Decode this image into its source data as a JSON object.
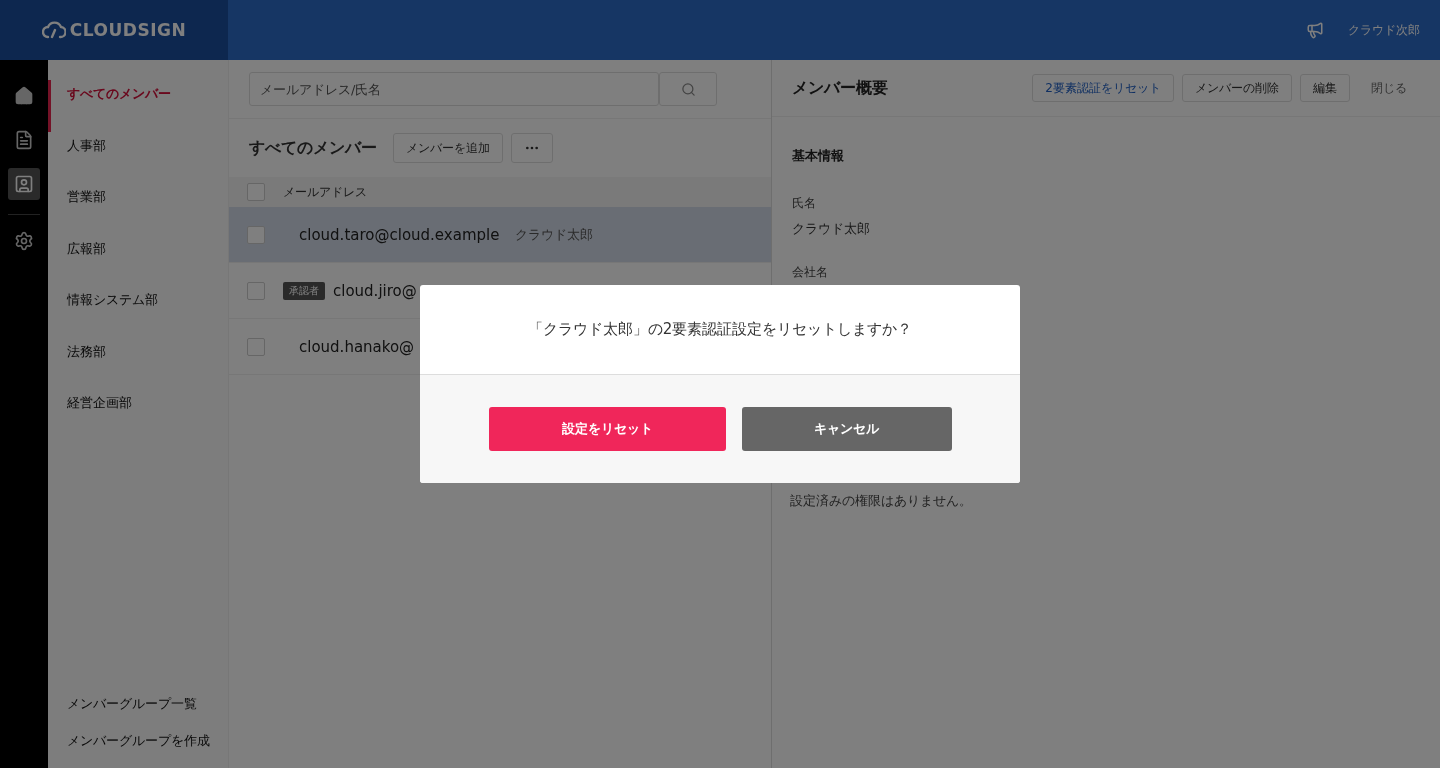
{
  "header": {
    "logo": "CLOUDSIGN",
    "user": "クラウド次郎"
  },
  "rail": [
    {
      "kind": "home",
      "selected": false
    },
    {
      "kind": "document",
      "selected": false
    },
    {
      "kind": "contact",
      "selected": true
    },
    {
      "kind": "settings",
      "selected": false
    }
  ],
  "sidebar": {
    "items": [
      {
        "label": "すべてのメンバー",
        "selected": true
      },
      {
        "label": "人事部",
        "selected": false
      },
      {
        "label": "営業部",
        "selected": false
      },
      {
        "label": "広報部",
        "selected": false
      },
      {
        "label": "情報システム部",
        "selected": false
      },
      {
        "label": "法務部",
        "selected": false
      },
      {
        "label": "経営企画部",
        "selected": false
      }
    ],
    "footer_links": [
      "メンバーグループ一覧",
      "メンバーグループを作成"
    ]
  },
  "members": {
    "search": {
      "placeholder": "メールアドレス/氏名"
    },
    "title": "すべてのメンバー",
    "add_button": "メンバーを追加",
    "column": "メールアドレス",
    "all_checked": false,
    "rows": [
      {
        "email": "cloud.taro@cloud.example",
        "name": "クラウド太郎",
        "selected": true,
        "checked": false
      },
      {
        "badge": "承認者",
        "email": "cloud.jiro@",
        "selected": false,
        "checked": false
      },
      {
        "email": "cloud.hanako@",
        "selected": false,
        "checked": false
      }
    ]
  },
  "detail": {
    "title": "メンバー概要",
    "buttons": [
      {
        "label": "2要素認証をリセット",
        "kind": "primary"
      },
      {
        "label": "メンバーの削除",
        "kind": "default"
      },
      {
        "label": "編集",
        "kind": "default"
      },
      {
        "label": "閉じる",
        "kind": "plain"
      }
    ],
    "section": "基本情報",
    "fields": [
      {
        "label": "氏名",
        "value": "クラウド太郎"
      },
      {
        "label": "会社名"
      }
    ],
    "note": "設定済みの権限はありません。"
  },
  "dialog": {
    "message": "「クラウド太郎」の2要素認証設定をリセットしますか？",
    "buttons": [
      {
        "label": "設定をリセット",
        "kind": "danger"
      },
      {
        "label": "キャンセル",
        "kind": "secondary"
      }
    ]
  }
}
